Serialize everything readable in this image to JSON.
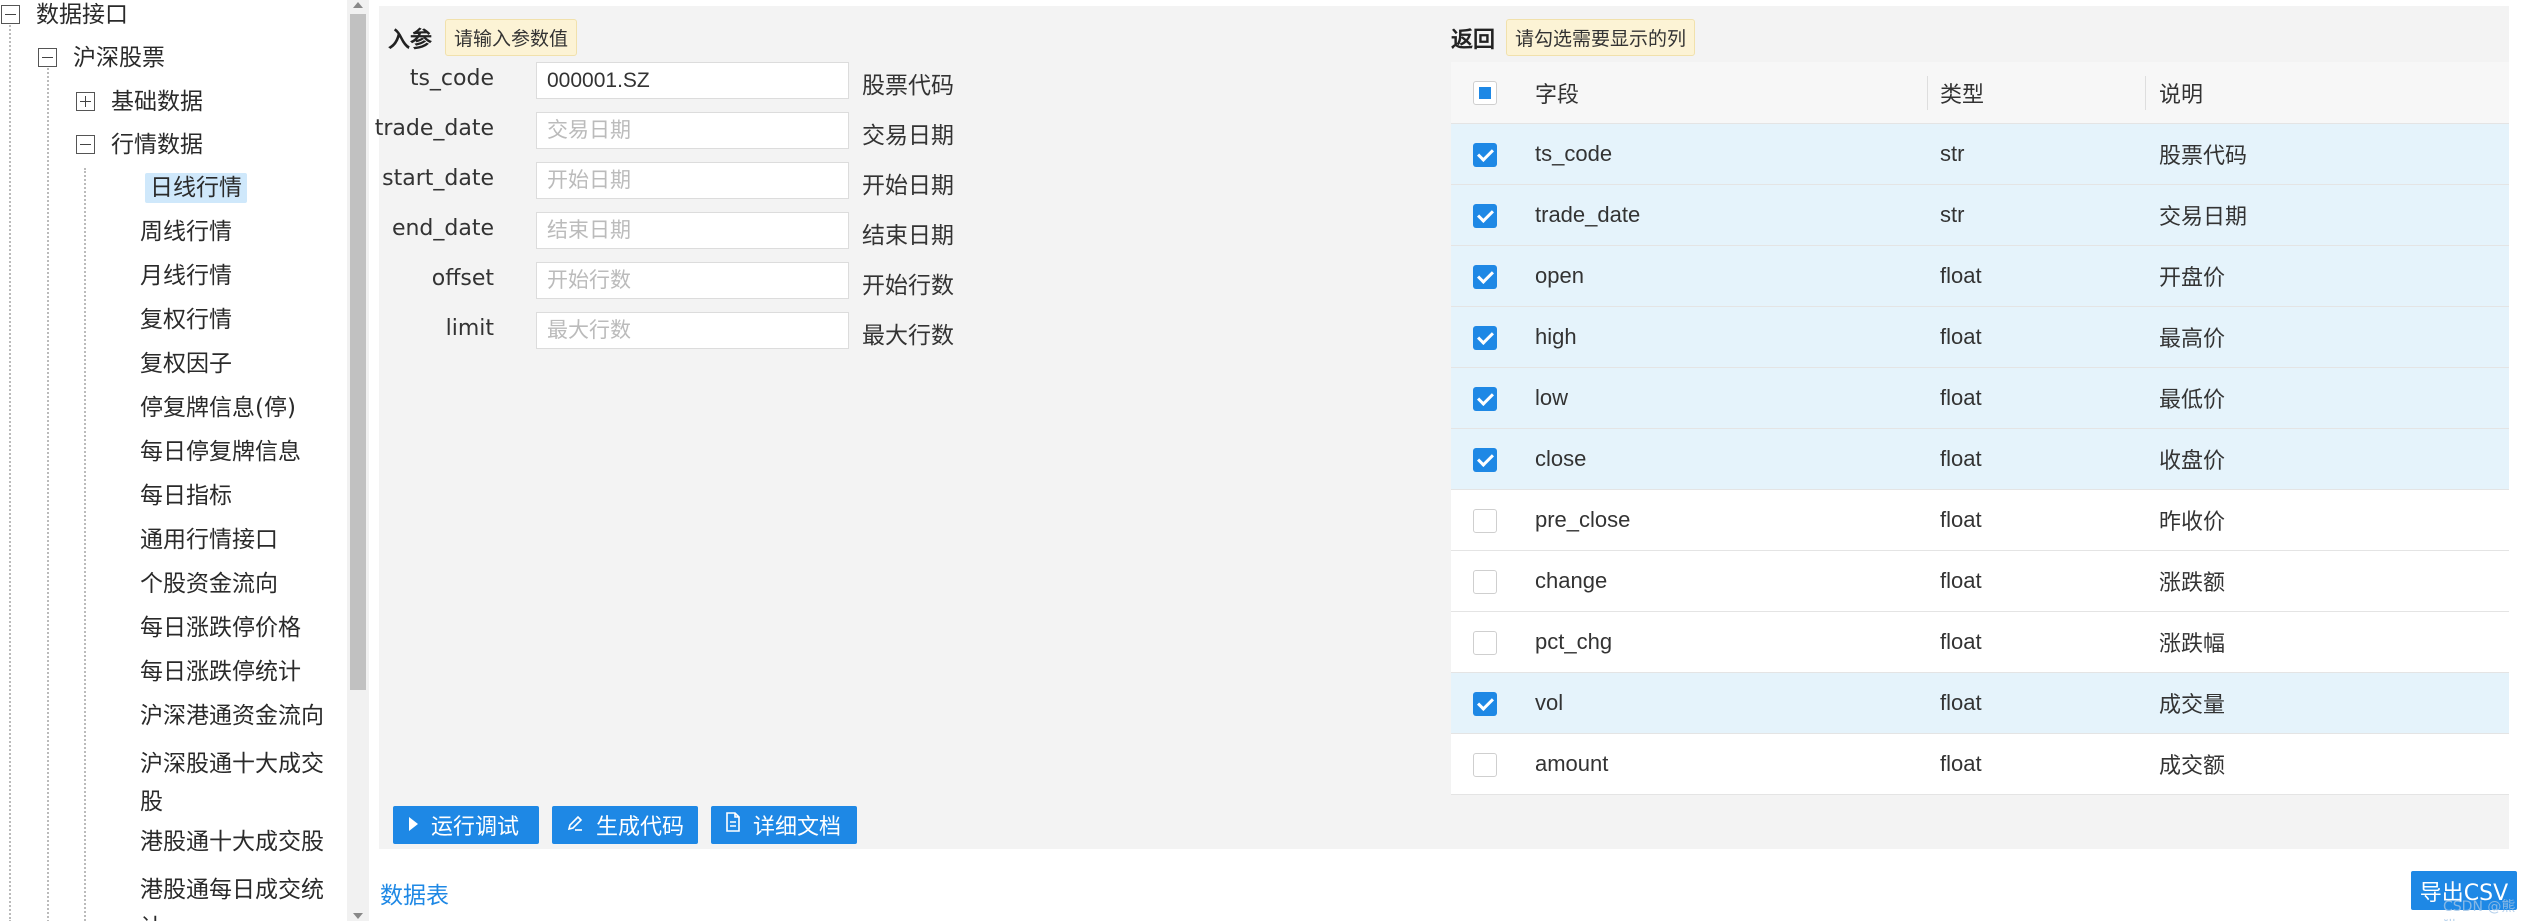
{
  "tree": {
    "root": "数据接口",
    "l1": "沪深股票",
    "l2_basic": "基础数据",
    "l2_quotes": "行情数据",
    "leaves": [
      "日线行情",
      "周线行情",
      "月线行情",
      "复权行情",
      "复权因子",
      "停复牌信息(停)",
      "每日停复牌信息",
      "每日指标",
      "通用行情接口",
      "个股资金流向",
      "每日涨跌停价格",
      "每日涨跌停统计",
      "沪深港通资金流向",
      "沪深股通十大成交股",
      "港股通十大成交股",
      "港股通每日成交统计"
    ],
    "selected": "日线行情"
  },
  "params": {
    "title": "入参",
    "hint": "请输入参数值",
    "rows": [
      {
        "name": "ts_code",
        "value": "000001.SZ",
        "placeholder": "",
        "desc": "股票代码"
      },
      {
        "name": "trade_date",
        "value": "",
        "placeholder": "交易日期",
        "desc": "交易日期"
      },
      {
        "name": "start_date",
        "value": "",
        "placeholder": "开始日期",
        "desc": "开始日期"
      },
      {
        "name": "end_date",
        "value": "",
        "placeholder": "结束日期",
        "desc": "结束日期"
      },
      {
        "name": "offset",
        "value": "",
        "placeholder": "开始行数",
        "desc": "开始行数"
      },
      {
        "name": "limit",
        "value": "",
        "placeholder": "最大行数",
        "desc": "最大行数"
      }
    ]
  },
  "buttons": {
    "run": "运行调试",
    "gen": "生成代码",
    "doc": "详细文档"
  },
  "returns": {
    "title": "返回",
    "hint": "请勾选需要显示的列",
    "headers": {
      "field": "字段",
      "type": "类型",
      "desc": "说明"
    },
    "rows": [
      {
        "field": "ts_code",
        "type": "str",
        "desc": "股票代码",
        "checked": true
      },
      {
        "field": "trade_date",
        "type": "str",
        "desc": "交易日期",
        "checked": true
      },
      {
        "field": "open",
        "type": "float",
        "desc": "开盘价",
        "checked": true
      },
      {
        "field": "high",
        "type": "float",
        "desc": "最高价",
        "checked": true
      },
      {
        "field": "low",
        "type": "float",
        "desc": "最低价",
        "checked": true
      },
      {
        "field": "close",
        "type": "float",
        "desc": "收盘价",
        "checked": true
      },
      {
        "field": "pre_close",
        "type": "float",
        "desc": "昨收价",
        "checked": false
      },
      {
        "field": "change",
        "type": "float",
        "desc": "涨跌额",
        "checked": false
      },
      {
        "field": "pct_chg",
        "type": "float",
        "desc": "涨跌幅",
        "checked": false
      },
      {
        "field": "vol",
        "type": "float",
        "desc": "成交量",
        "checked": true
      },
      {
        "field": "amount",
        "type": "float",
        "desc": "成交额",
        "checked": false
      }
    ]
  },
  "footer": {
    "datatable": "数据表",
    "export": "导出CSV",
    "watermark": "CSDN @熊猫"
  },
  "colors": {
    "accent": "#1e88e5",
    "selected_row": "#e5f3fb",
    "hint_bg": "#fcf3d5"
  }
}
